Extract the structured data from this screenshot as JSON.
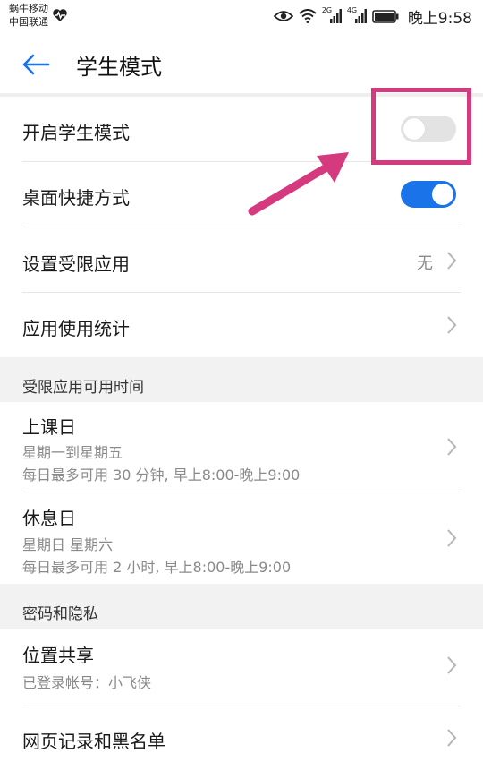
{
  "status_bar": {
    "carrier_1": "蜗牛移动",
    "carrier_2": "中国联通",
    "network_2g": "2G",
    "network_4g": "4G",
    "time": "晚上9:58"
  },
  "header": {
    "title": "学生模式"
  },
  "settings": {
    "student_mode": {
      "label": "开启学生模式",
      "enabled": false
    },
    "desktop_shortcut": {
      "label": "桌面快捷方式",
      "enabled": true
    },
    "restricted_apps": {
      "label": "设置受限应用",
      "value": "无"
    },
    "app_usage_stats": {
      "label": "应用使用统计"
    }
  },
  "sections": {
    "available_time": {
      "title": "受限应用可用时间",
      "school_day": {
        "label": "上课日",
        "days": "星期一到星期五",
        "limit": "每日最多可用 30 分钟, 早上8:00-晚上9:00"
      },
      "rest_day": {
        "label": "休息日",
        "days": "星期日 星期六",
        "limit": "每日最多可用 2 小时, 早上8:00-晚上9:00"
      }
    },
    "password_privacy": {
      "title": "密码和隐私",
      "location_sharing": {
        "label": "位置共享",
        "account": "已登录帐号：小飞侠"
      },
      "web_history": {
        "label": "网页记录和黑名单"
      }
    }
  },
  "colors": {
    "accent": "#1a73e8",
    "annotation": "#d63a7e",
    "toggle_off": "#e3e3e3"
  }
}
